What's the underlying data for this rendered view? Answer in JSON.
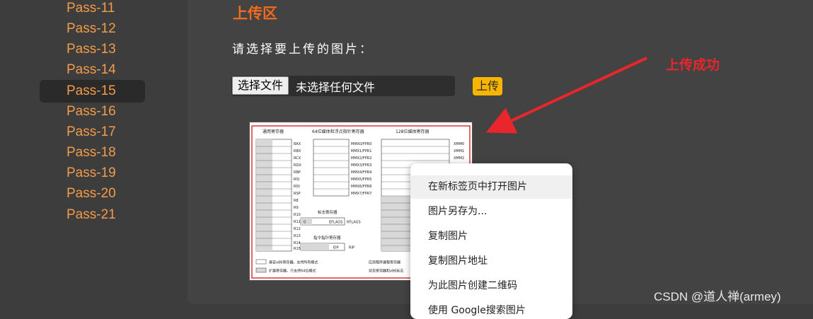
{
  "sidebar": {
    "items": [
      {
        "label": "Pass-11",
        "active": false
      },
      {
        "label": "Pass-12",
        "active": false
      },
      {
        "label": "Pass-13",
        "active": false
      },
      {
        "label": "Pass-14",
        "active": false
      },
      {
        "label": "Pass-15",
        "active": true
      },
      {
        "label": "Pass-16",
        "active": false
      },
      {
        "label": "Pass-17",
        "active": false
      },
      {
        "label": "Pass-18",
        "active": false
      },
      {
        "label": "Pass-19",
        "active": false
      },
      {
        "label": "Pass-20",
        "active": false
      },
      {
        "label": "Pass-21",
        "active": false
      }
    ]
  },
  "main": {
    "title": "上传区",
    "prompt": "请选择要上传的图片：",
    "file_button": "选择文件",
    "file_status": "未选择任何文件",
    "upload_button": "上传"
  },
  "annotation": {
    "text": "上传成功",
    "color": "#e8262c"
  },
  "uploaded_image": {
    "header_general": "通用寄存器",
    "header_mmx": "64位媒体和浮点指针寄存器",
    "header_xmm": "128位媒体寄存器",
    "gp_registers": [
      "RAX",
      "RBX",
      "RCX",
      "RDX",
      "RBP",
      "RSI",
      "RDI",
      "RSP",
      "R8",
      "R9",
      "R10",
      "R11",
      "R12",
      "R13",
      "R14",
      "R15"
    ],
    "mmx_registers": [
      "MMX0/FPR0",
      "MMX1/FPR1",
      "MMX2/FPR2",
      "MMX3/FPR3",
      "MMX4/FPR4",
      "MMX5/FPR5",
      "MMX6/FPR6",
      "MMX7/FPR7"
    ],
    "xmm_registers": [
      "XMM0",
      "XMM1",
      "XMM2"
    ],
    "flags_title": "标志寄存器",
    "flags_box": "EFLAGS",
    "flags_name": "RFLAGS",
    "ip_title": "指令指针寄存器",
    "ip_box": "EIP",
    "ip_name": "RIP",
    "legend_1": "兼容x86寄存器，支持所有模式",
    "legend_2": "扩展寄存器，只支持64位模式",
    "footer_1": "应用程序编程寄存器",
    "footer_2": "状态寄存器和x86标志"
  },
  "context_menu": {
    "items": [
      {
        "label": "在新标签页中打开图片",
        "hover": true
      },
      {
        "label": "图片另存为...",
        "hover": false
      },
      {
        "label": "复制图片",
        "hover": false
      },
      {
        "label": "复制图片地址",
        "hover": false
      },
      {
        "label": "为此图片创建二维码",
        "hover": false
      },
      {
        "label": "使用 Google搜索图片",
        "hover": false
      }
    ]
  },
  "watermark": "CSDN @道人禅(armey)",
  "colors": {
    "nav_text": "#f29b4a",
    "title": "#f26b1d",
    "upload_button": "#f7b500",
    "arrow": "#e8262c"
  }
}
